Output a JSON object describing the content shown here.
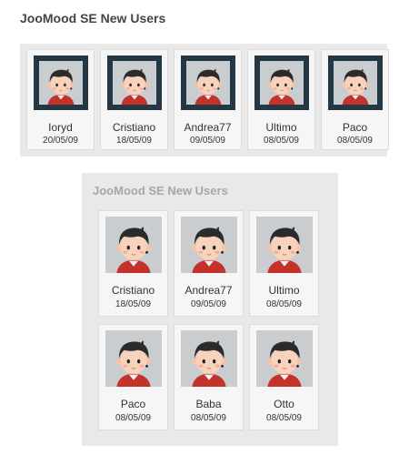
{
  "widget_top": {
    "title": "JooMood SE New Users",
    "users": [
      {
        "name": "Ioryd",
        "date": "20/05/09"
      },
      {
        "name": "Cristiano",
        "date": "18/05/09"
      },
      {
        "name": "Andrea77",
        "date": "09/05/09"
      },
      {
        "name": "Ultimo",
        "date": "08/05/09"
      },
      {
        "name": "Paco",
        "date": "08/05/09"
      }
    ]
  },
  "widget_bottom": {
    "title": "JooMood SE New Users",
    "users": [
      {
        "name": "Cristiano",
        "date": "18/05/09"
      },
      {
        "name": "Andrea77",
        "date": "09/05/09"
      },
      {
        "name": "Ultimo",
        "date": "08/05/09"
      },
      {
        "name": "Paco",
        "date": "08/05/09"
      },
      {
        "name": "Baba",
        "date": "08/05/09"
      },
      {
        "name": "Otto",
        "date": "08/05/09"
      }
    ]
  },
  "colors": {
    "frame": "#233744",
    "panel": "#e9e9e9",
    "card": "#f6f6f6"
  },
  "icons": {
    "avatar": "default-user-avatar-icon"
  }
}
